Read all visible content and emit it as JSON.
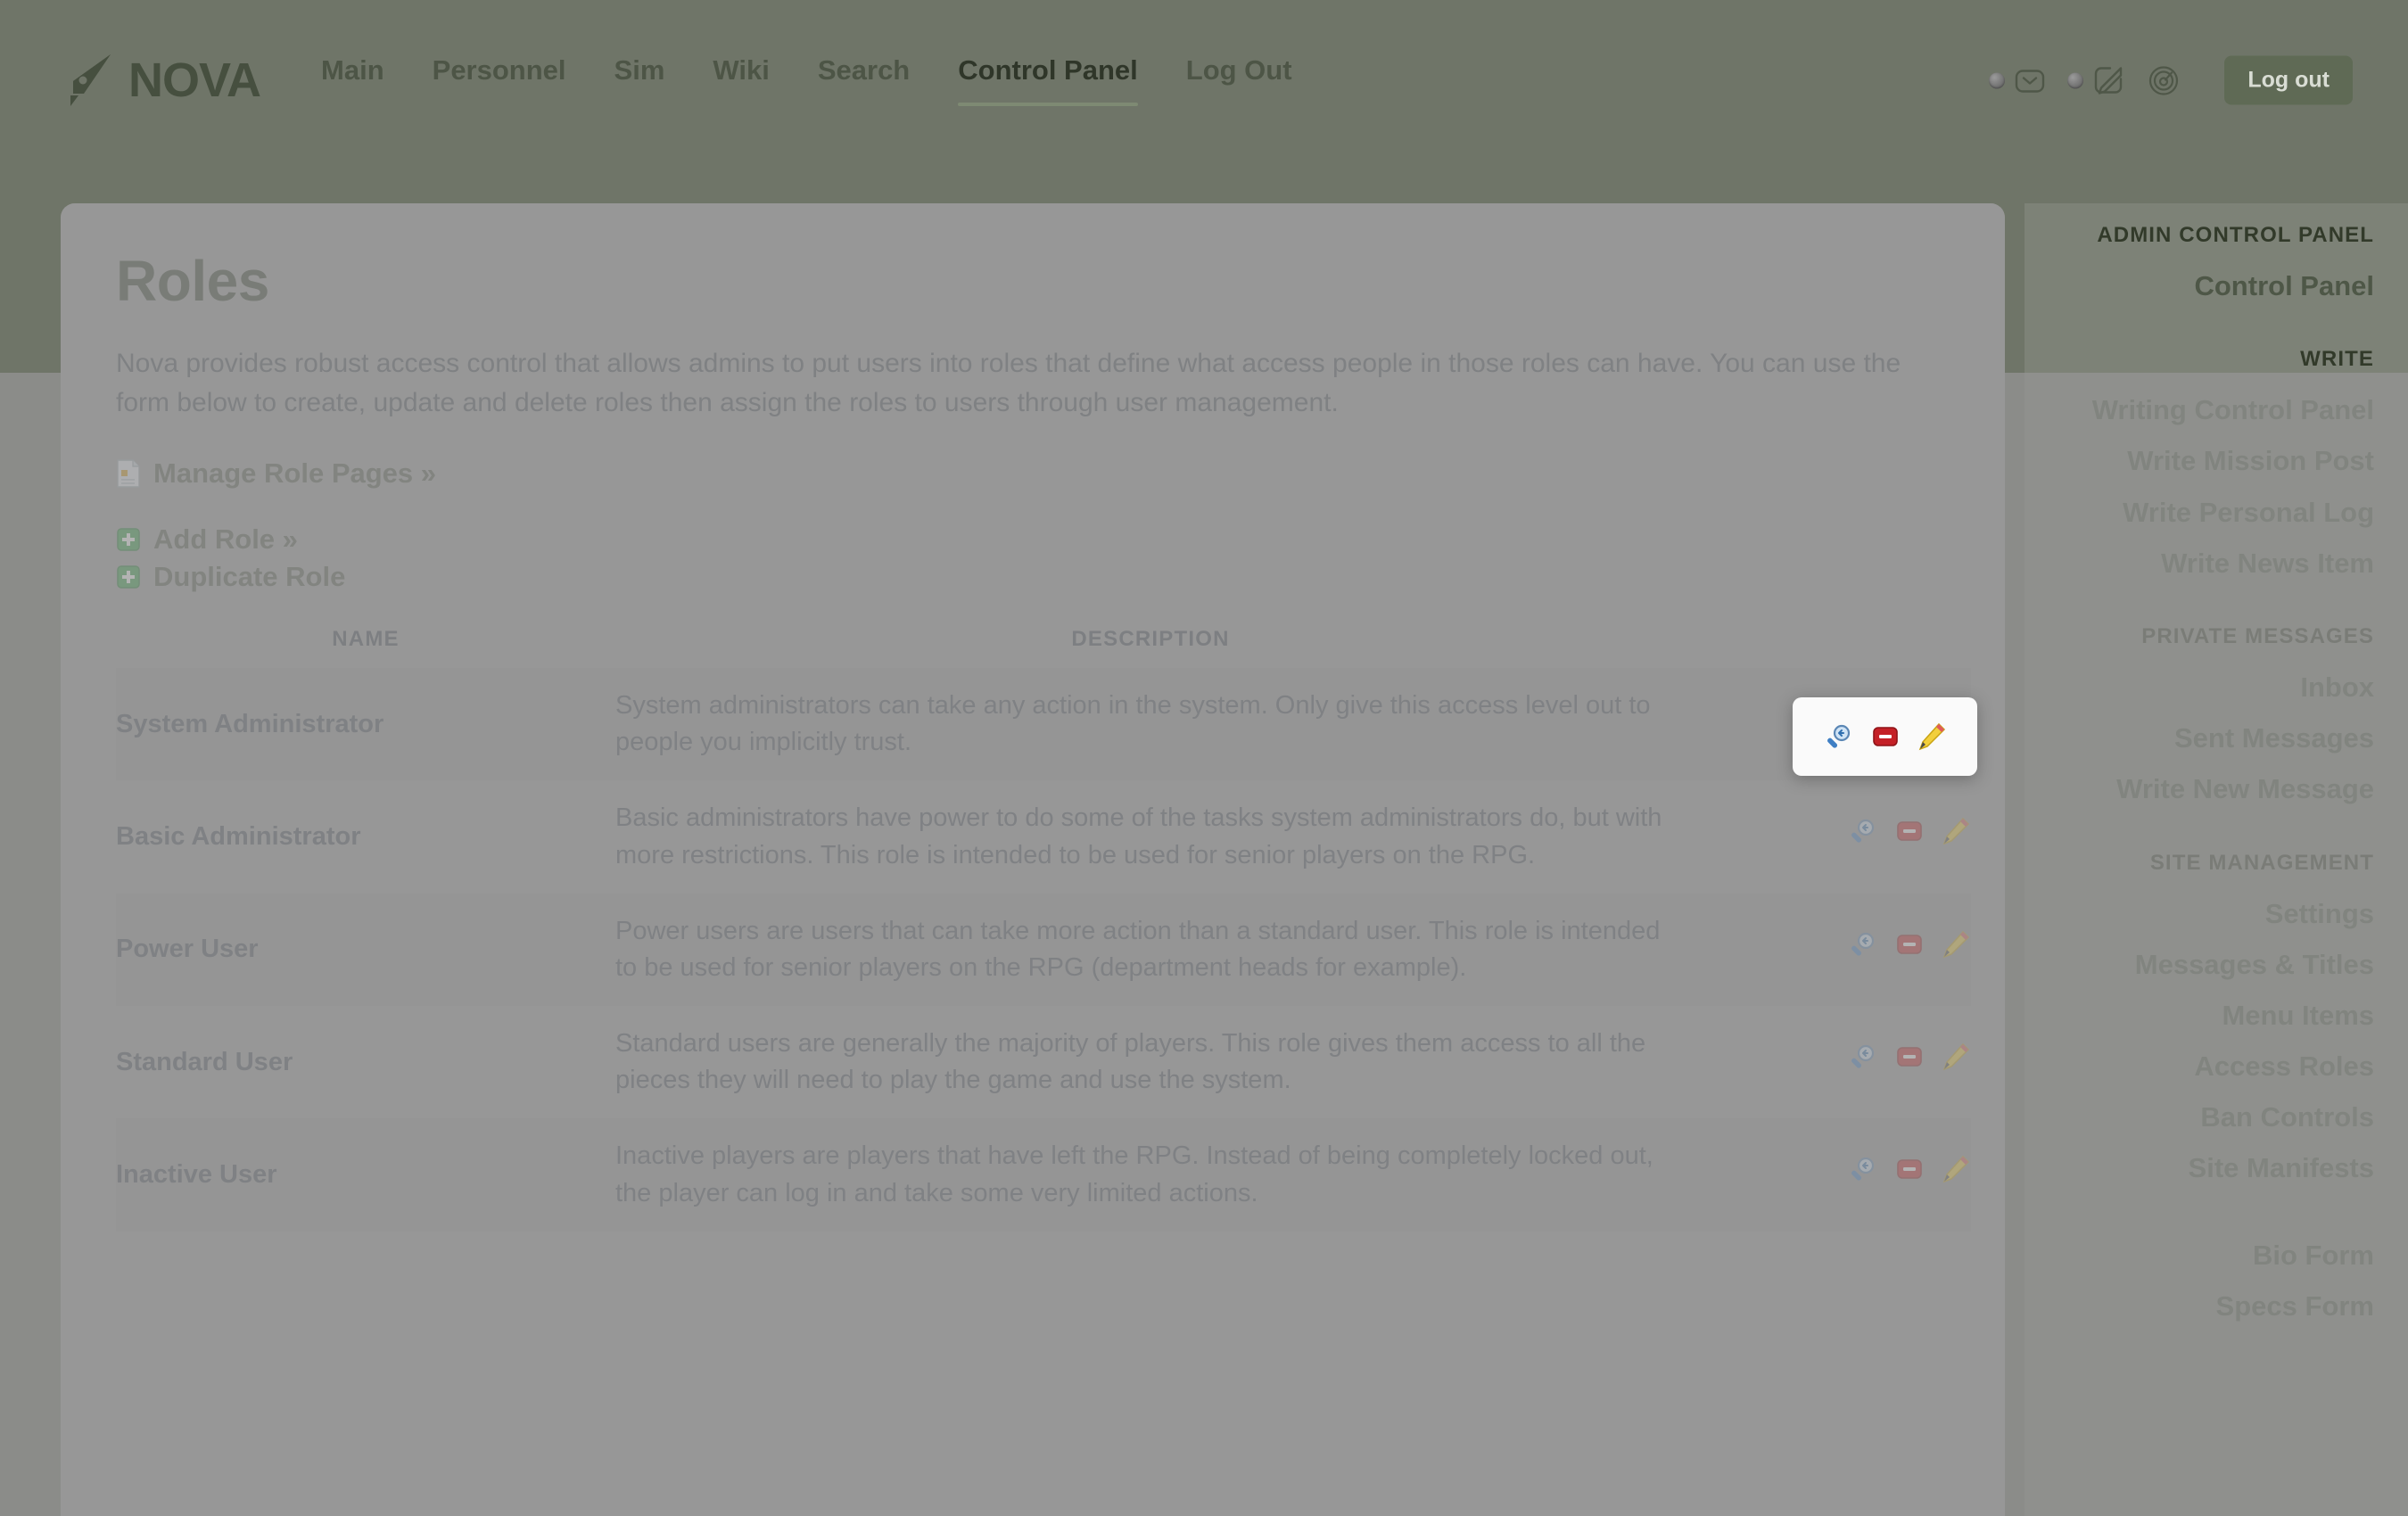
{
  "header": {
    "brand": "NOVA",
    "nav": [
      {
        "label": "Main",
        "active": false
      },
      {
        "label": "Personnel",
        "active": false
      },
      {
        "label": "Sim",
        "active": false
      },
      {
        "label": "Wiki",
        "active": false
      },
      {
        "label": "Search",
        "active": false
      },
      {
        "label": "Control Panel",
        "active": true
      },
      {
        "label": "Log Out",
        "active": false
      }
    ],
    "icons": [
      {
        "name": "mail-icon",
        "badge": true
      },
      {
        "name": "pencil-square-icon",
        "badge": true
      },
      {
        "name": "radar-icon",
        "badge": false
      }
    ],
    "logout_label": "Log out"
  },
  "main": {
    "title": "Roles",
    "intro": "Nova provides robust access control that allows admins to put users into roles that define what access people in those roles can have. You can use the form below to create, update and delete roles then assign the roles to users through user management.",
    "links": [
      {
        "label": "Manage Role Pages »",
        "icon": "page-icon"
      },
      {
        "label": "Add Role »",
        "icon": "plus-green-icon"
      },
      {
        "label": "Duplicate Role",
        "icon": "plus-green-icon"
      }
    ],
    "table": {
      "columns": [
        "NAME",
        "DESCRIPTION",
        ""
      ],
      "rows": [
        {
          "name": "System Administrator",
          "description": "System administrators can take any action in the system. Only give this access level out to people you implicitly trust.",
          "actions": [
            "view-icon",
            "delete-icon",
            "edit-icon"
          ]
        },
        {
          "name": "Basic Administrator",
          "description": "Basic administrators have power to do some of the tasks system administrators do, but with more restrictions. This role is intended to be used for senior players on the RPG.",
          "actions": [
            "view-icon",
            "delete-icon",
            "edit-icon"
          ]
        },
        {
          "name": "Power User",
          "description": "Power users are users that can take more action than a standard user. This role is intended to be used for senior players on the RPG (department heads for example).",
          "actions": [
            "view-icon",
            "delete-icon",
            "edit-icon"
          ]
        },
        {
          "name": "Standard User",
          "description": "Standard users are generally the majority of players. This role gives them access to all the pieces they will need to play the game and use the system.",
          "actions": [
            "view-icon",
            "delete-icon",
            "edit-icon"
          ]
        },
        {
          "name": "Inactive User",
          "description": "Inactive players are players that have left the RPG. Instead of being completely locked out, the player can log in and take some very limited actions.",
          "actions": [
            "view-icon",
            "delete-icon",
            "edit-icon"
          ]
        }
      ]
    }
  },
  "popover": {
    "actions": [
      {
        "name": "view-icon"
      },
      {
        "name": "delete-icon"
      },
      {
        "name": "edit-icon"
      }
    ]
  },
  "sidebar": {
    "groups": [
      {
        "heading": "ADMIN CONTROL PANEL",
        "items": [
          "Control Panel"
        ]
      },
      {
        "heading": "WRITE",
        "items": [
          "Writing Control Panel",
          "Write Mission Post",
          "Write Personal Log",
          "Write News Item"
        ]
      },
      {
        "heading": "PRIVATE MESSAGES",
        "items": [
          "Inbox",
          "Sent Messages",
          "Write New Message"
        ]
      },
      {
        "heading": "SITE MANAGEMENT",
        "items": [
          "Settings",
          "Messages & Titles",
          "Menu Items",
          "Access Roles",
          "Ban Controls",
          "Site Manifests"
        ]
      },
      {
        "heading": "",
        "items": [
          "Bio Form",
          "Specs Form"
        ]
      }
    ]
  },
  "colors": {
    "page_bg": "#6f7568",
    "card_bg": "#9a9a9a",
    "sidebar_bg": "#7d8277",
    "brand_dark": "#464f3f",
    "accent_underline": "#7e8a73",
    "logout_bg": "#5f6a55",
    "delete_red": "#c42026",
    "add_green": "#2f9e41",
    "dim_overlay": "#969696"
  }
}
